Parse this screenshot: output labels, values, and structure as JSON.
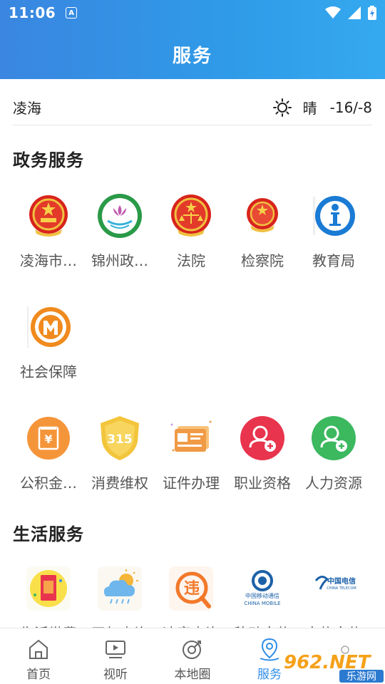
{
  "status_bar": {
    "time": "11:06",
    "notif_icon": "A"
  },
  "header": {
    "title": "服务"
  },
  "weather": {
    "city": "凌海",
    "icon": "sun-icon",
    "condition": "晴",
    "temperature": "-16/-8"
  },
  "sections": {
    "gov": {
      "title": "政务服务",
      "items": [
        {
          "label": "凌海市…",
          "icon": "national-emblem-icon"
        },
        {
          "label": "锦州政…",
          "icon": "jinzhou-gov-logo-icon"
        },
        {
          "label": "法院",
          "icon": "court-emblem-icon"
        },
        {
          "label": "检察院",
          "icon": "procuratorate-emblem-icon"
        },
        {
          "label": "教育局",
          "icon": "education-bureau-icon"
        },
        {
          "label": "社会保障",
          "icon": "social-security-icon"
        }
      ]
    },
    "services": {
      "items": [
        {
          "label": "公积金…",
          "icon": "housing-fund-icon",
          "color": "#f5953a"
        },
        {
          "label": "消费维权",
          "icon": "consumer-rights-315-icon",
          "color": "#f3c53c"
        },
        {
          "label": "证件办理",
          "icon": "id-card-icon",
          "color": "#f09a46"
        },
        {
          "label": "职业资格",
          "icon": "vocational-qualification-icon",
          "color": "#e8344d"
        },
        {
          "label": "人力资源",
          "icon": "human-resources-icon",
          "color": "#3cb85f"
        }
      ]
    },
    "life": {
      "title": "生活服务",
      "items": [
        {
          "label": "生活缴费",
          "icon": "bill-payment-icon"
        },
        {
          "label": "天气查询",
          "icon": "weather-query-icon"
        },
        {
          "label": "违章查询",
          "icon": "traffic-violation-icon"
        },
        {
          "label": "移动文传",
          "icon": "china-mobile-icon",
          "logo_cn": "中国移动通信",
          "logo_en": "CHINA MOBILE"
        },
        {
          "label": "电信文传",
          "icon": "china-telecom-icon",
          "logo_cn": "中国电信",
          "logo_en": "CHINA TELECOM"
        }
      ]
    }
  },
  "bottom_nav": [
    {
      "label": "首页",
      "icon": "home-icon",
      "active": false
    },
    {
      "label": "视听",
      "icon": "tv-icon",
      "active": false
    },
    {
      "label": "本地圈",
      "icon": "local-circle-icon",
      "active": false
    },
    {
      "label": "服务",
      "icon": "location-pin-icon",
      "active": true
    }
  ],
  "watermark": {
    "text_top": "962.NET",
    "text_bottom": "乐游网"
  },
  "colors": {
    "header_blue": "#3a8fe6",
    "active_blue": "#2f8ee8"
  }
}
